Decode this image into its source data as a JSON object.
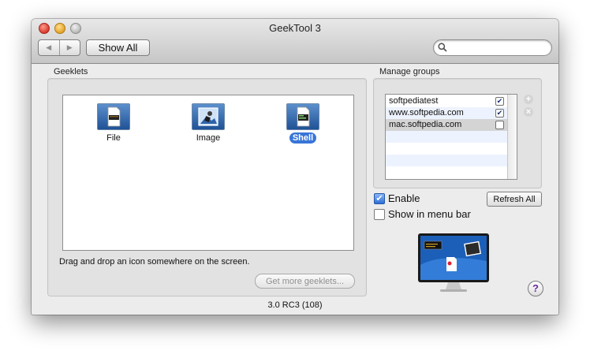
{
  "window": {
    "title": "GeekTool 3",
    "show_all_label": "Show All",
    "search": {
      "placeholder": "",
      "value": ""
    },
    "version": "3.0 RC3 (108)"
  },
  "geeklets": {
    "section_label": "Geeklets",
    "items": [
      {
        "label": "File",
        "icon": "file-geeklet-icon",
        "selected": false
      },
      {
        "label": "Image",
        "icon": "image-geeklet-icon",
        "selected": false
      },
      {
        "label": "Shell",
        "icon": "shell-geeklet-icon",
        "selected": true
      }
    ],
    "drag_hint": "Drag and drop an icon somewhere on the screen.",
    "get_more_label": "Get more geeklets..."
  },
  "groups": {
    "section_label": "Manage groups",
    "rows": [
      {
        "name": "softpediatest",
        "checked": true
      },
      {
        "name": "www.softpedia.com",
        "checked": true
      },
      {
        "name": "mac.softpedia.com",
        "checked": false
      }
    ],
    "add_icon": "plus-icon",
    "remove_icon": "close-icon"
  },
  "options": {
    "enable_label": "Enable",
    "enable_checked": true,
    "menu_bar_label": "Show in menu bar",
    "menu_bar_checked": false,
    "refresh_label": "Refresh All"
  },
  "help_label": "?",
  "colors": {
    "selection": "#3875d7",
    "help_glyph": "#6a2ea0"
  }
}
